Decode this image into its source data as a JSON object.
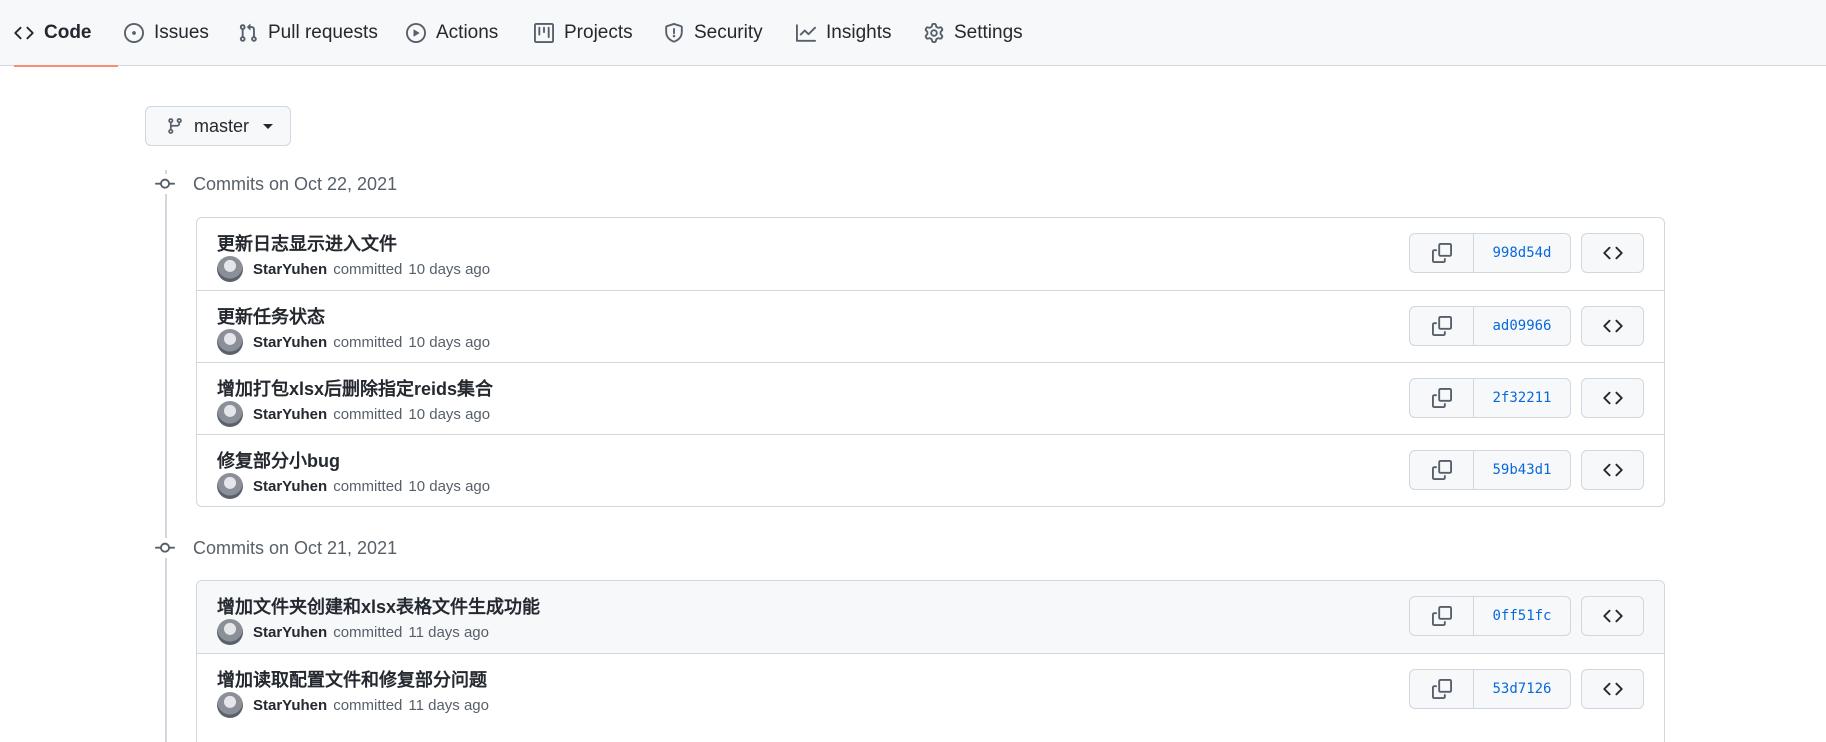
{
  "nav": {
    "tabs": [
      {
        "label": "Code",
        "icon": "code-icon",
        "selected": true
      },
      {
        "label": "Issues",
        "icon": "issue-opened-icon"
      },
      {
        "label": "Pull requests",
        "icon": "git-pull-request-icon"
      },
      {
        "label": "Actions",
        "icon": "play-icon"
      },
      {
        "label": "Projects",
        "icon": "project-icon"
      },
      {
        "label": "Security",
        "icon": "shield-icon"
      },
      {
        "label": "Insights",
        "icon": "graph-icon"
      },
      {
        "label": "Settings",
        "icon": "gear-icon"
      }
    ],
    "accent_color": "#fd8c73"
  },
  "branch": {
    "name": "master"
  },
  "groups": [
    {
      "heading": "Commits on Oct 22, 2021",
      "commits": [
        {
          "message": "更新日志显示进入文件",
          "author": "StarYuhen",
          "action": "committed",
          "time": "10 days ago",
          "sha": "998d54d"
        },
        {
          "message": "更新任务状态",
          "author": "StarYuhen",
          "action": "committed",
          "time": "10 days ago",
          "sha": "ad09966"
        },
        {
          "message": "增加打包xlsx后删除指定reids集合",
          "author": "StarYuhen",
          "action": "committed",
          "time": "10 days ago",
          "sha": "2f32211"
        },
        {
          "message": "修复部分小bug",
          "author": "StarYuhen",
          "action": "committed",
          "time": "10 days ago",
          "sha": "59b43d1"
        }
      ]
    },
    {
      "heading": "Commits on Oct 21, 2021",
      "commits": [
        {
          "message": "增加文件夹创建和xlsx表格文件生成功能",
          "author": "StarYuhen",
          "action": "committed",
          "time": "11 days ago",
          "sha": "0ff51fc"
        },
        {
          "message": "增加读取配置文件和修复部分问题",
          "author": "StarYuhen",
          "action": "committed",
          "time": "11 days ago",
          "sha": "53d7126"
        }
      ]
    }
  ]
}
